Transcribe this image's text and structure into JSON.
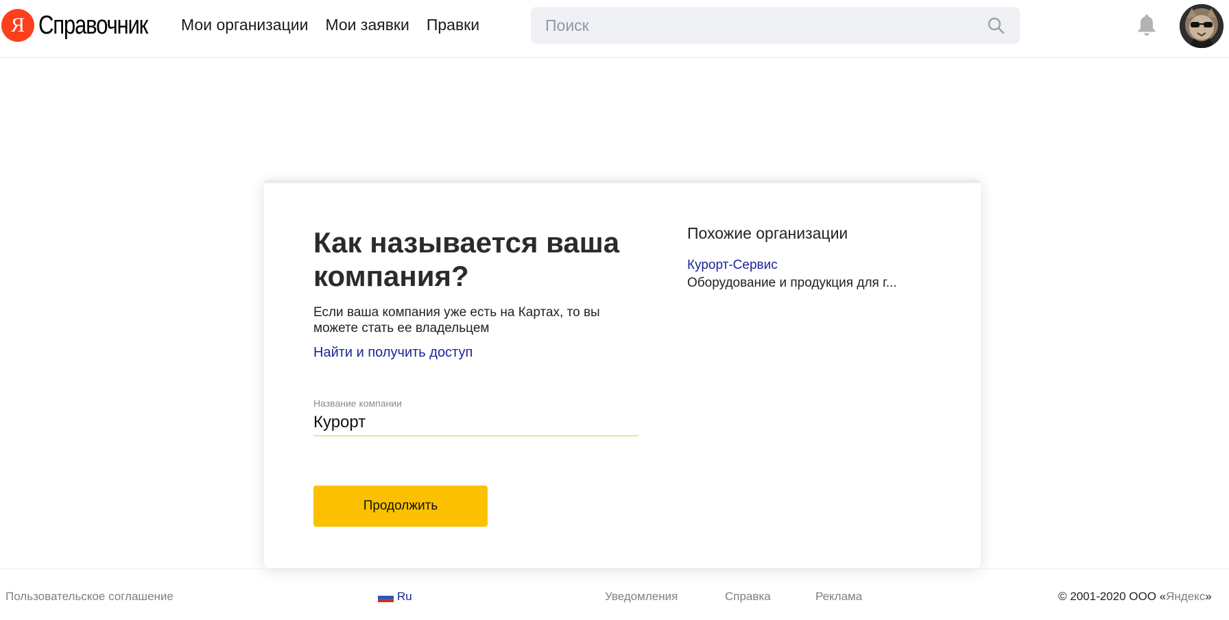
{
  "header": {
    "logo_letter": "Я",
    "logo_text": "Справочник",
    "nav": [
      {
        "label": "Мои организации"
      },
      {
        "label": "Мои заявки"
      },
      {
        "label": "Правки"
      }
    ],
    "search": {
      "placeholder": "Поиск",
      "value": ""
    },
    "notifications_icon": "bell-icon",
    "avatar_icon": "user-avatar"
  },
  "form": {
    "title": "Как называется ваша компания?",
    "lead": "Если ваша компания уже есть на Картах, то вы можете стать ее владельцем",
    "find_link": "Найти и получить доступ",
    "company_name_label": "Название компании",
    "company_name_value": "Курорт",
    "continue_label": "Продолжить"
  },
  "similar": {
    "title": "Похожие организации",
    "items": [
      {
        "name": "Курорт-Сервис",
        "description": "Оборудование и продукция для г..."
      }
    ]
  },
  "footer": {
    "agreement": "Пользовательское соглашение",
    "language": "Ru",
    "notifications": "Уведомления",
    "help": "Справка",
    "ads": "Реклама",
    "copyright_prefix": "© 2001-2020  ООО «",
    "copyright_link": "Яндекс",
    "copyright_suffix": "»"
  },
  "colors": {
    "brand_red": "#fc3f1d",
    "button_yellow": "#fbc100",
    "link_blue": "#1a2596",
    "input_underline": "#e8c93a"
  }
}
